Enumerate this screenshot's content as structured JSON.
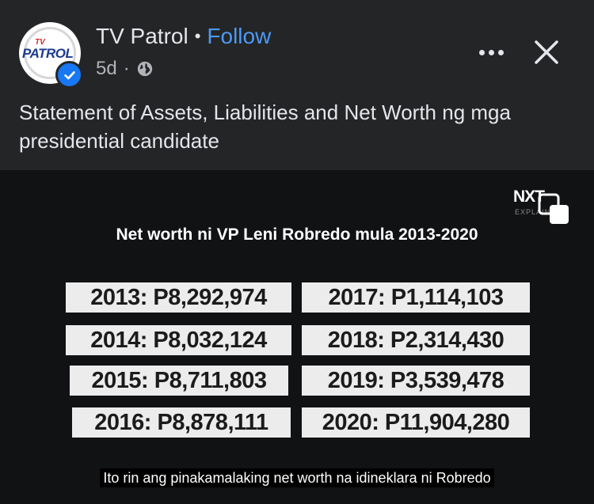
{
  "post": {
    "page_name": "TV Patrol",
    "separator": "•",
    "follow_label": "Follow",
    "time_ago": "5d",
    "time_separator": "·",
    "privacy_icon": "globe-icon",
    "avatar_logo_top": "TV",
    "avatar_logo_main": "PATROL",
    "caption": "Statement of Assets, Liabilities and Net Worth ng mga presidential candidate"
  },
  "video": {
    "brand": "NXT",
    "brand_sub": "EXPLAINS",
    "title": "Net worth ni VP Leni Robredo mula 2013-2020",
    "entries": [
      "2013: P8,292,974",
      "2014: P8,032,124",
      "2015: P8,711,803",
      "2016: P8,878,111",
      "2017: P1,114,103",
      "2018: P2,314,430",
      "2019: P3,539,478",
      "2020: P11,904,280"
    ],
    "subtitle": "Ito rin ang pinakamalaking net worth na idineklara ni Robredo"
  },
  "colors": {
    "background": "#242526",
    "follow": "#4c9af5",
    "verified_badge": "#1877f2",
    "video_background": "#101214"
  }
}
